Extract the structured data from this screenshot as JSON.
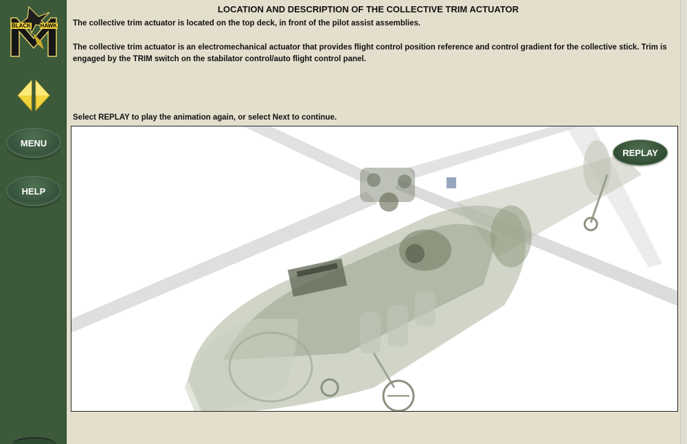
{
  "sidebar": {
    "logo": {
      "word_left": "BLACK",
      "word_right": "HAWK",
      "icon": "black-hawk-logo-icon"
    },
    "prev_icon": "triangle-left-icon",
    "next_icon": "triangle-right-icon",
    "menu_label": "MENU",
    "help_label": "HELP"
  },
  "content": {
    "title": "LOCATION AND DESCRIPTION OF THE COLLECTIVE TRIM ACTUATOR",
    "paragraph_1": "The collective trim actuator is located on the top deck, in front of the pilot assist assemblies.",
    "paragraph_2": "The collective trim actuator is an electromechanical actuator that provides flight control position reference and control gradient for the collective stick. Trim is engaged by the TRIM switch on the stabilator control/auto flight control panel.",
    "instruction": "Select REPLAY to play the animation again, or select Next to continue."
  },
  "viewer": {
    "replay_label": "REPLAY",
    "illustration": "helicopter-xray-illustration"
  },
  "colors": {
    "sidebar": "#3c5a3a",
    "background": "#e4dfcd",
    "arrow": "#f2d43c",
    "button": "#34513a"
  }
}
